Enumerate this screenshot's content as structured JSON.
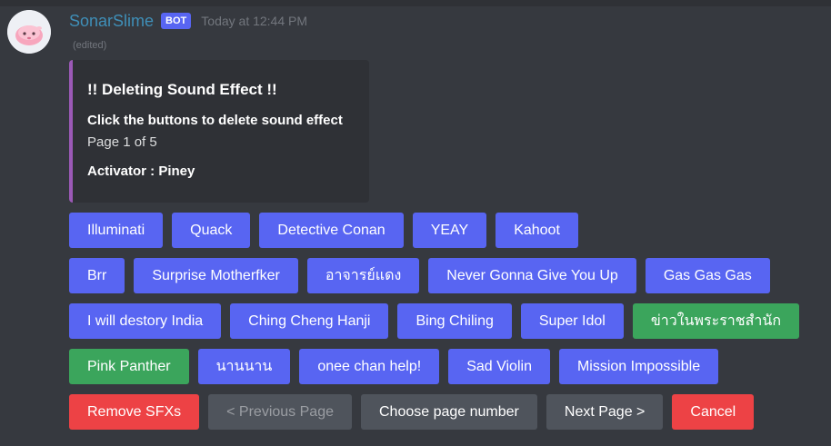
{
  "message": {
    "username": "SonarSlime",
    "bot_tag": "BOT",
    "timestamp": "Today at 12:44 PM",
    "edited": "(edited)"
  },
  "embed": {
    "title": "!! Deleting Sound Effect !!",
    "field_name": "Click the buttons to delete sound effect",
    "field_value": "Page 1 of 5",
    "activator": "Activator : Piney",
    "accent_color": "#9b59b6"
  },
  "rows": [
    [
      {
        "label": "Illuminati",
        "style": "blurple"
      },
      {
        "label": "Quack",
        "style": "blurple"
      },
      {
        "label": "Detective Conan",
        "style": "blurple"
      },
      {
        "label": "YEAY",
        "style": "blurple"
      },
      {
        "label": "Kahoot",
        "style": "blurple"
      }
    ],
    [
      {
        "label": "Brr",
        "style": "blurple"
      },
      {
        "label": "Surprise Motherfker",
        "style": "blurple"
      },
      {
        "label": "อาจารย์แดง",
        "style": "blurple"
      },
      {
        "label": "Never Gonna Give You Up",
        "style": "blurple"
      },
      {
        "label": "Gas Gas Gas",
        "style": "blurple"
      }
    ],
    [
      {
        "label": "I will destory India",
        "style": "blurple"
      },
      {
        "label": "Ching Cheng Hanji",
        "style": "blurple"
      },
      {
        "label": "Bing Chiling",
        "style": "blurple"
      },
      {
        "label": "Super Idol",
        "style": "blurple"
      },
      {
        "label": "ข่าวในพระราชสำนัก",
        "style": "green"
      }
    ],
    [
      {
        "label": "Pink Panther",
        "style": "green"
      },
      {
        "label": "นานนาน",
        "style": "blurple"
      },
      {
        "label": "onee chan help!",
        "style": "blurple"
      },
      {
        "label": "Sad Violin",
        "style": "blurple"
      },
      {
        "label": "Mission Impossible",
        "style": "blurple"
      }
    ],
    [
      {
        "label": "Remove SFXs",
        "style": "red"
      },
      {
        "label": "< Previous Page",
        "style": "grey",
        "disabled": true
      },
      {
        "label": "Choose page number",
        "style": "grey"
      },
      {
        "label": "Next Page >",
        "style": "grey"
      },
      {
        "label": "Cancel",
        "style": "red"
      }
    ]
  ],
  "colors": {
    "background": "#36393f",
    "blurple": "#5865f2",
    "green": "#3ba55c",
    "red": "#ed4245",
    "grey": "#4f545c",
    "username": "#3f8fb8"
  },
  "icons": {
    "avatar": "pink-slime-avatar"
  }
}
